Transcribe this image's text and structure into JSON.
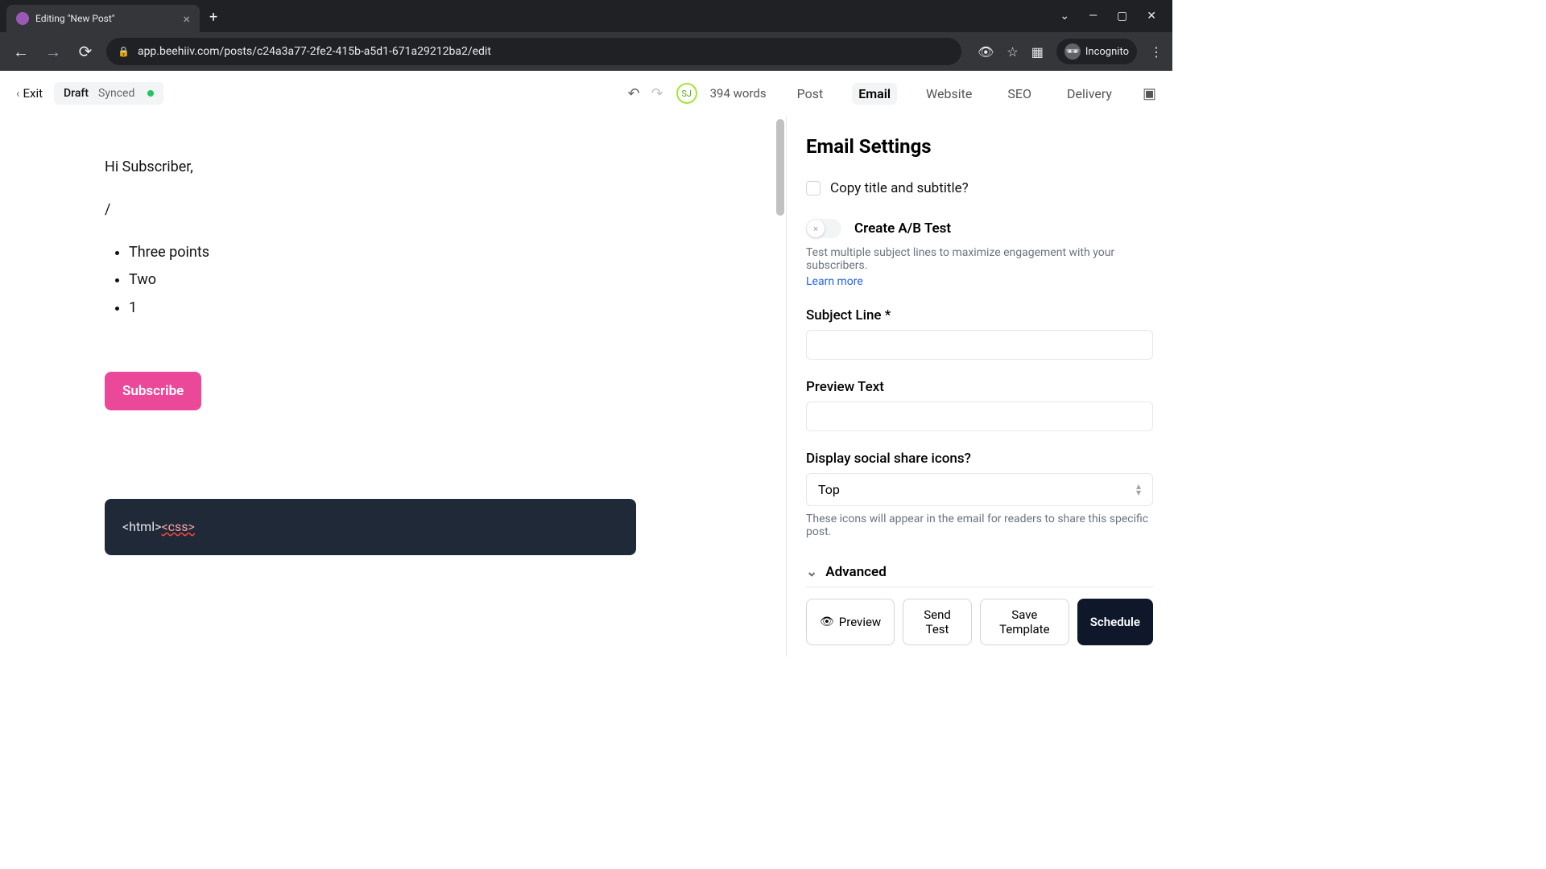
{
  "browser": {
    "tab_title": "Editing \"New Post\"",
    "url": "app.beehiiv.com/posts/c24a3a77-2fe2-415b-a5d1-671a29212ba2/edit",
    "incognito_label": "Incognito"
  },
  "topbar": {
    "exit_label": "Exit",
    "draft_label": "Draft",
    "synced_label": "Synced",
    "avatar_initials": "SJ",
    "word_count": "394 words",
    "tabs": [
      "Post",
      "Email",
      "Website",
      "SEO",
      "Delivery"
    ],
    "active_tab_index": 1
  },
  "editor": {
    "greeting": "Hi Subscriber,",
    "slash": "/",
    "bullets": [
      "Three points",
      "Two",
      "1"
    ],
    "subscribe_label": "Subscribe",
    "code_html": "<html>",
    "code_css": "<css>"
  },
  "panel": {
    "title": "Email Settings",
    "copy_checkbox_label": "Copy title and subtitle?",
    "abtest_label": "Create A/B Test",
    "abtest_help": "Test multiple subject lines to maximize engagement with your subscribers.",
    "learn_more": "Learn more",
    "subject_label": "Subject Line *",
    "subject_value": "",
    "preview_label": "Preview Text",
    "preview_value": "",
    "social_label": "Display social share icons?",
    "social_selected": "Top",
    "social_hint": "These icons will appear in the email for readers to share this specific post.",
    "advanced_label": "Advanced"
  },
  "footer": {
    "preview": "Preview",
    "send_test": "Send Test",
    "save_template": "Save Template",
    "schedule": "Schedule"
  }
}
